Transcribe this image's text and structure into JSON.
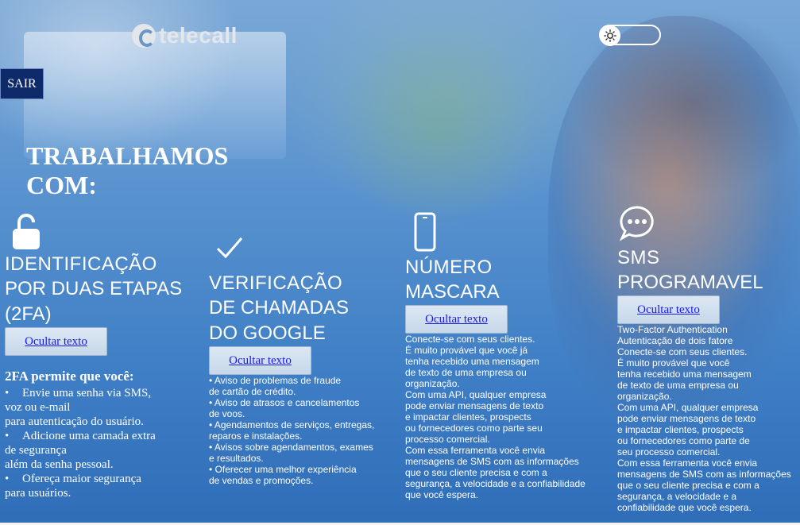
{
  "brand": {
    "logo_text": "telecall"
  },
  "header": {
    "theme_toggle_icon": "sun-icon"
  },
  "sair_label": "SAIR",
  "headline": "TRABALHAMOS COM:",
  "services": {
    "twofa": {
      "icon": "unlock-icon",
      "title_line1": "IDENTIFICAÇÃO",
      "title_line2": "POR DUAS ETAPAS",
      "title_line3": "(2FA)",
      "button_label": "Ocultar texto",
      "body_heading": "2FA permite que você:",
      "bullets": [
        {
          "a": "Envie uma senha via SMS,",
          "b": "voz ou e-mail",
          "c": "para autenticação do usuário."
        },
        {
          "a": "Adicione uma camada extra",
          "b": "de segurança",
          "c": "além da senha pessoal."
        },
        {
          "a": "Ofereça maior segurança",
          "b": "para usuários."
        }
      ]
    },
    "google": {
      "icon": "check-icon",
      "title_line1": "VERIFICAÇÃO",
      "title_line2": "DE CHAMADAS",
      "title_line3": "DO GOOGLE",
      "button_label": "Ocultar texto",
      "lines": [
        "• Aviso de problemas de fraude",
        "de cartão de crédito.",
        "• Aviso de atrasos e cancelamentos",
        "de voos.",
        "• Agendamentos de serviços, entregas,",
        "reparos e instalações.",
        "• Avisos sobre agendamentos, exames",
        "e resultados.",
        "• Oferecer uma melhor experiência",
        "de vendas e promoções."
      ]
    },
    "numero": {
      "icon": "smartphone-icon",
      "title_line1": "NÚMERO",
      "title_line2": "MASCARA",
      "button_label": "Ocultar texto",
      "lines": [
        "Conecte-se com seus clientes.",
        "É muito provável que você já",
        "tenha recebido uma mensagem",
        "de texto de uma empresa ou",
        "organização.",
        "Com uma API, qualquer empresa",
        "pode enviar mensagens de texto",
        "e impactar clientes, prospects",
        "ou fornecedores como parte seu",
        "processo comercial.",
        "Com essa ferramenta você envia",
        "mensagens de SMS com as informações",
        "que o seu cliente precisa e com a",
        "segurança, a velocidade e a confiabilidade",
        "que você espera."
      ]
    },
    "sms": {
      "icon": "chat-bubble-icon",
      "title_line1": "SMS",
      "title_line2": "PROGRAMAVEL",
      "button_label": "Ocultar texto",
      "lines": [
        "Two-Factor Authentication",
        "Autenticação de dois fatore",
        "Conecte-se com seus clientes.",
        "É muito provável que você",
        "tenha recebido uma mensagem",
        "de texto de uma empresa ou",
        "organização.",
        "Com uma API, qualquer empresa",
        "pode enviar mensagens de texto",
        "e impactar clientes, prospects",
        "ou fornecedores como parte de",
        "seu processo comercial.",
        "Com essa ferramenta você envia",
        "mensagens de SMS com as informações",
        "que o seu cliente precisa e com a",
        "segurança, a velocidade e a",
        "confiabilidade que você espera."
      ]
    }
  }
}
